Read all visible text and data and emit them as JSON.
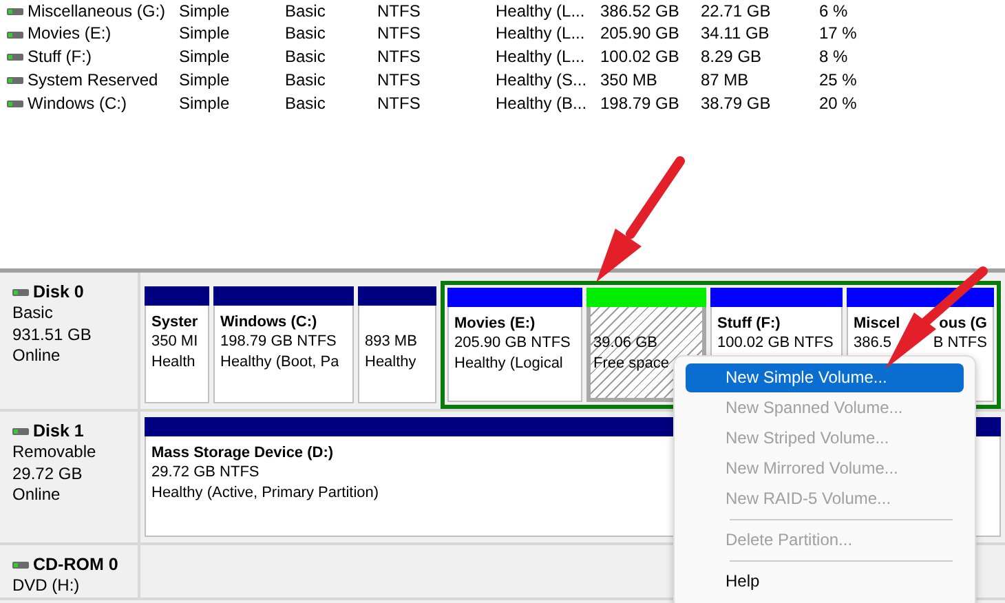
{
  "volumes": [
    {
      "name": "Miscellaneous (G:)",
      "layout": "Simple",
      "type": "Basic",
      "file_system": "NTFS",
      "status": "Healthy (L...",
      "capacity": "386.52 GB",
      "free_space": "22.71 GB",
      "percent_free": "6 %"
    },
    {
      "name": "Movies (E:)",
      "layout": "Simple",
      "type": "Basic",
      "file_system": "NTFS",
      "status": "Healthy (L...",
      "capacity": "205.90 GB",
      "free_space": "34.11 GB",
      "percent_free": "17 %"
    },
    {
      "name": "Stuff (F:)",
      "layout": "Simple",
      "type": "Basic",
      "file_system": "NTFS",
      "status": "Healthy (L...",
      "capacity": "100.02 GB",
      "free_space": "8.29 GB",
      "percent_free": "8 %"
    },
    {
      "name": "System Reserved",
      "layout": "Simple",
      "type": "Basic",
      "file_system": "NTFS",
      "status": "Healthy (S...",
      "capacity": "350 MB",
      "free_space": "87 MB",
      "percent_free": "25 %"
    },
    {
      "name": "Windows (C:)",
      "layout": "Simple",
      "type": "Basic",
      "file_system": "NTFS",
      "status": "Healthy (B...",
      "capacity": "198.79 GB",
      "free_space": "38.79 GB",
      "percent_free": "20 %"
    }
  ],
  "disks": [
    {
      "kind": "disk",
      "name": "Disk 0",
      "type": "Basic",
      "size": "931.51 GB",
      "status": "Online",
      "partitions": [
        {
          "kind": "primary",
          "title": "Syster",
          "size": "350 MI",
          "status": "Health"
        },
        {
          "kind": "primary",
          "title": "Windows  (C:)",
          "size": "198.79 GB NTFS",
          "status": "Healthy (Boot, Pa"
        },
        {
          "kind": "primary",
          "size": "893 MB",
          "status": "Healthy"
        },
        {
          "kind": "extended",
          "selected": true,
          "children": [
            {
              "kind": "logical",
              "title": "Movies  (E:)",
              "size": "205.90 GB NTFS",
              "status": "Healthy (Logical"
            },
            {
              "kind": "free",
              "size": "39.06 GB",
              "status": "Free space"
            },
            {
              "kind": "logical",
              "title": "Stuff  (F:)",
              "size": "100.02 GB NTFS"
            },
            {
              "kind": "logical",
              "title_parts": [
                "Miscel",
                "ous  (G"
              ],
              "size_parts": [
                "386.5",
                "B NTFS"
              ]
            }
          ]
        }
      ]
    },
    {
      "kind": "disk",
      "name": "Disk 1",
      "type": "Removable",
      "size": "29.72 GB",
      "status": "Online",
      "partitions": [
        {
          "kind": "primary",
          "title": "Mass Storage Device  (D:)",
          "size": "29.72 GB NTFS",
          "status": "Healthy (Active, Primary Partition)"
        }
      ]
    },
    {
      "kind": "cdrom",
      "name": "CD-ROM 0",
      "type": "DVD (H:)"
    }
  ],
  "context_menu": [
    {
      "kind": "item",
      "label": "New Simple Volume...",
      "selected": true,
      "disabled": false
    },
    {
      "kind": "item",
      "label": "New Spanned Volume...",
      "selected": false,
      "disabled": true
    },
    {
      "kind": "item",
      "label": "New Striped Volume...",
      "selected": false,
      "disabled": true
    },
    {
      "kind": "item",
      "label": "New Mirrored Volume...",
      "selected": false,
      "disabled": true
    },
    {
      "kind": "item",
      "label": "New RAID-5 Volume...",
      "selected": false,
      "disabled": true
    },
    {
      "kind": "separator"
    },
    {
      "kind": "item",
      "label": "Delete Partition...",
      "selected": false,
      "disabled": true
    },
    {
      "kind": "separator"
    },
    {
      "kind": "item",
      "label": "Help",
      "selected": false,
      "disabled": false
    }
  ]
}
